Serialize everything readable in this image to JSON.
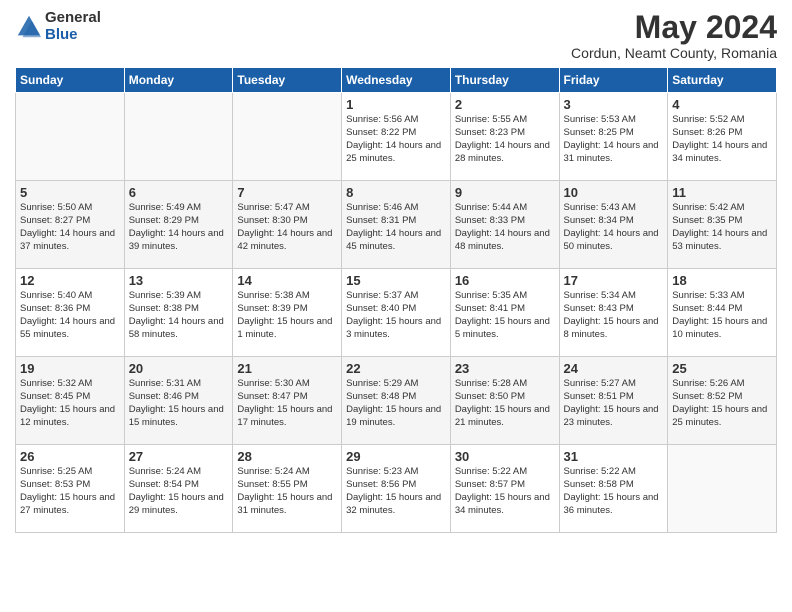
{
  "header": {
    "logo_general": "General",
    "logo_blue": "Blue",
    "month_title": "May 2024",
    "subtitle": "Cordun, Neamt County, Romania"
  },
  "days_of_week": [
    "Sunday",
    "Monday",
    "Tuesday",
    "Wednesday",
    "Thursday",
    "Friday",
    "Saturday"
  ],
  "weeks": [
    [
      {
        "day": "",
        "sunrise": "",
        "sunset": "",
        "daylight": ""
      },
      {
        "day": "",
        "sunrise": "",
        "sunset": "",
        "daylight": ""
      },
      {
        "day": "",
        "sunrise": "",
        "sunset": "",
        "daylight": ""
      },
      {
        "day": "1",
        "sunrise": "Sunrise: 5:56 AM",
        "sunset": "Sunset: 8:22 PM",
        "daylight": "Daylight: 14 hours and 25 minutes."
      },
      {
        "day": "2",
        "sunrise": "Sunrise: 5:55 AM",
        "sunset": "Sunset: 8:23 PM",
        "daylight": "Daylight: 14 hours and 28 minutes."
      },
      {
        "day": "3",
        "sunrise": "Sunrise: 5:53 AM",
        "sunset": "Sunset: 8:25 PM",
        "daylight": "Daylight: 14 hours and 31 minutes."
      },
      {
        "day": "4",
        "sunrise": "Sunrise: 5:52 AM",
        "sunset": "Sunset: 8:26 PM",
        "daylight": "Daylight: 14 hours and 34 minutes."
      }
    ],
    [
      {
        "day": "5",
        "sunrise": "Sunrise: 5:50 AM",
        "sunset": "Sunset: 8:27 PM",
        "daylight": "Daylight: 14 hours and 37 minutes."
      },
      {
        "day": "6",
        "sunrise": "Sunrise: 5:49 AM",
        "sunset": "Sunset: 8:29 PM",
        "daylight": "Daylight: 14 hours and 39 minutes."
      },
      {
        "day": "7",
        "sunrise": "Sunrise: 5:47 AM",
        "sunset": "Sunset: 8:30 PM",
        "daylight": "Daylight: 14 hours and 42 minutes."
      },
      {
        "day": "8",
        "sunrise": "Sunrise: 5:46 AM",
        "sunset": "Sunset: 8:31 PM",
        "daylight": "Daylight: 14 hours and 45 minutes."
      },
      {
        "day": "9",
        "sunrise": "Sunrise: 5:44 AM",
        "sunset": "Sunset: 8:33 PM",
        "daylight": "Daylight: 14 hours and 48 minutes."
      },
      {
        "day": "10",
        "sunrise": "Sunrise: 5:43 AM",
        "sunset": "Sunset: 8:34 PM",
        "daylight": "Daylight: 14 hours and 50 minutes."
      },
      {
        "day": "11",
        "sunrise": "Sunrise: 5:42 AM",
        "sunset": "Sunset: 8:35 PM",
        "daylight": "Daylight: 14 hours and 53 minutes."
      }
    ],
    [
      {
        "day": "12",
        "sunrise": "Sunrise: 5:40 AM",
        "sunset": "Sunset: 8:36 PM",
        "daylight": "Daylight: 14 hours and 55 minutes."
      },
      {
        "day": "13",
        "sunrise": "Sunrise: 5:39 AM",
        "sunset": "Sunset: 8:38 PM",
        "daylight": "Daylight: 14 hours and 58 minutes."
      },
      {
        "day": "14",
        "sunrise": "Sunrise: 5:38 AM",
        "sunset": "Sunset: 8:39 PM",
        "daylight": "Daylight: 15 hours and 1 minute."
      },
      {
        "day": "15",
        "sunrise": "Sunrise: 5:37 AM",
        "sunset": "Sunset: 8:40 PM",
        "daylight": "Daylight: 15 hours and 3 minutes."
      },
      {
        "day": "16",
        "sunrise": "Sunrise: 5:35 AM",
        "sunset": "Sunset: 8:41 PM",
        "daylight": "Daylight: 15 hours and 5 minutes."
      },
      {
        "day": "17",
        "sunrise": "Sunrise: 5:34 AM",
        "sunset": "Sunset: 8:43 PM",
        "daylight": "Daylight: 15 hours and 8 minutes."
      },
      {
        "day": "18",
        "sunrise": "Sunrise: 5:33 AM",
        "sunset": "Sunset: 8:44 PM",
        "daylight": "Daylight: 15 hours and 10 minutes."
      }
    ],
    [
      {
        "day": "19",
        "sunrise": "Sunrise: 5:32 AM",
        "sunset": "Sunset: 8:45 PM",
        "daylight": "Daylight: 15 hours and 12 minutes."
      },
      {
        "day": "20",
        "sunrise": "Sunrise: 5:31 AM",
        "sunset": "Sunset: 8:46 PM",
        "daylight": "Daylight: 15 hours and 15 minutes."
      },
      {
        "day": "21",
        "sunrise": "Sunrise: 5:30 AM",
        "sunset": "Sunset: 8:47 PM",
        "daylight": "Daylight: 15 hours and 17 minutes."
      },
      {
        "day": "22",
        "sunrise": "Sunrise: 5:29 AM",
        "sunset": "Sunset: 8:48 PM",
        "daylight": "Daylight: 15 hours and 19 minutes."
      },
      {
        "day": "23",
        "sunrise": "Sunrise: 5:28 AM",
        "sunset": "Sunset: 8:50 PM",
        "daylight": "Daylight: 15 hours and 21 minutes."
      },
      {
        "day": "24",
        "sunrise": "Sunrise: 5:27 AM",
        "sunset": "Sunset: 8:51 PM",
        "daylight": "Daylight: 15 hours and 23 minutes."
      },
      {
        "day": "25",
        "sunrise": "Sunrise: 5:26 AM",
        "sunset": "Sunset: 8:52 PM",
        "daylight": "Daylight: 15 hours and 25 minutes."
      }
    ],
    [
      {
        "day": "26",
        "sunrise": "Sunrise: 5:25 AM",
        "sunset": "Sunset: 8:53 PM",
        "daylight": "Daylight: 15 hours and 27 minutes."
      },
      {
        "day": "27",
        "sunrise": "Sunrise: 5:24 AM",
        "sunset": "Sunset: 8:54 PM",
        "daylight": "Daylight: 15 hours and 29 minutes."
      },
      {
        "day": "28",
        "sunrise": "Sunrise: 5:24 AM",
        "sunset": "Sunset: 8:55 PM",
        "daylight": "Daylight: 15 hours and 31 minutes."
      },
      {
        "day": "29",
        "sunrise": "Sunrise: 5:23 AM",
        "sunset": "Sunset: 8:56 PM",
        "daylight": "Daylight: 15 hours and 32 minutes."
      },
      {
        "day": "30",
        "sunrise": "Sunrise: 5:22 AM",
        "sunset": "Sunset: 8:57 PM",
        "daylight": "Daylight: 15 hours and 34 minutes."
      },
      {
        "day": "31",
        "sunrise": "Sunrise: 5:22 AM",
        "sunset": "Sunset: 8:58 PM",
        "daylight": "Daylight: 15 hours and 36 minutes."
      },
      {
        "day": "",
        "sunrise": "",
        "sunset": "",
        "daylight": ""
      }
    ]
  ]
}
